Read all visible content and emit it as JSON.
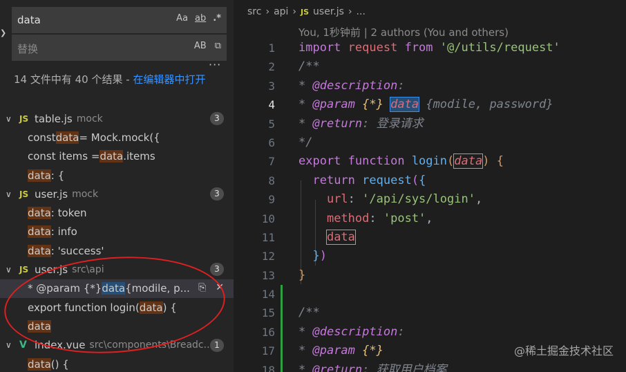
{
  "search": {
    "query": "data",
    "opt_case": "Aa",
    "opt_word": "ab",
    "opt_regex": ".*",
    "replace_placeholder": "替换",
    "replace_opt": "AB",
    "more": "···",
    "summary_prefix": "14 文件中有 40 个结果 - ",
    "summary_link": "在编辑器中打开"
  },
  "results": [
    {
      "name": "table.js",
      "path": "mock",
      "count": "3",
      "icon": "JS",
      "matches": [
        {
          "pre": "const ",
          "hit": "data",
          "post": " = Mock.mock({"
        },
        {
          "pre": "const items = ",
          "hit": "data",
          "post": ".items"
        },
        {
          "pre": "",
          "hit": "data",
          "post": ": {"
        }
      ]
    },
    {
      "name": "user.js",
      "path": "mock",
      "count": "3",
      "icon": "JS",
      "matches": [
        {
          "pre": "",
          "hit": "data",
          "post": ": token"
        },
        {
          "pre": "",
          "hit": "data",
          "post": ": info"
        },
        {
          "pre": "",
          "hit": "data",
          "post": ": 'success'"
        }
      ]
    },
    {
      "name": "user.js",
      "path": "src\\api",
      "count": "3",
      "icon": "JS",
      "matches": [
        {
          "pre": "* @param {*} ",
          "hit": "data",
          "post": " {modile, p..."
        },
        {
          "pre": "export function login(",
          "hit": "data",
          "post": ") {"
        },
        {
          "pre": "",
          "hit": "data",
          "post": ""
        }
      ]
    },
    {
      "name": "index.vue",
      "path": "src\\components\\Breadc...",
      "count": "1",
      "icon": "V",
      "matches": [
        {
          "pre": "",
          "hit": "data",
          "post": "() {"
        }
      ]
    }
  ],
  "editor": {
    "breadcrumb": [
      "src",
      "api",
      "user.js",
      "..."
    ],
    "blame": "You, 1秒钟前 | 2 authors (You and others)",
    "line_numbers": [
      "1",
      "2",
      "3",
      "4",
      "5",
      "6",
      "7",
      "8",
      "9",
      "10",
      "11",
      "12",
      "13",
      "14",
      "15",
      "16",
      "17",
      "18"
    ],
    "active_line": "4",
    "lines": {
      "l1": [
        "import",
        " ",
        "request",
        " ",
        "from",
        " ",
        "'@/utils/request'"
      ],
      "l2": "/**",
      "l3": [
        "* ",
        "@description",
        ":"
      ],
      "l4": [
        "* ",
        "@param",
        " ",
        "{*}",
        " ",
        "data",
        " ",
        "{modile, password}"
      ],
      "l5": [
        "* ",
        "@return",
        ":",
        " 登录请求"
      ],
      "l6": "*/",
      "l7": [
        "export",
        " ",
        "function",
        " ",
        "login",
        "(",
        "data",
        ")",
        " ",
        "{"
      ],
      "l8": [
        "  ",
        "return",
        " ",
        "request",
        "(",
        "{"
      ],
      "l9": [
        "    ",
        "url",
        ":",
        " ",
        "'/api/sys/login'",
        ","
      ],
      "l10": [
        "    ",
        "method",
        ":",
        " ",
        "'post'",
        ","
      ],
      "l11": [
        "    ",
        "data"
      ],
      "l12": [
        "  ",
        "}",
        ")"
      ],
      "l13": "}",
      "l14": "",
      "l15": "/**",
      "l16": [
        "* ",
        "@description",
        ":"
      ],
      "l17": [
        "* ",
        "@param",
        " ",
        "{*}"
      ],
      "l18": [
        "* ",
        "@return",
        ":",
        " 获取用户档案"
      ]
    }
  },
  "watermark": "@稀土掘金技术社区"
}
